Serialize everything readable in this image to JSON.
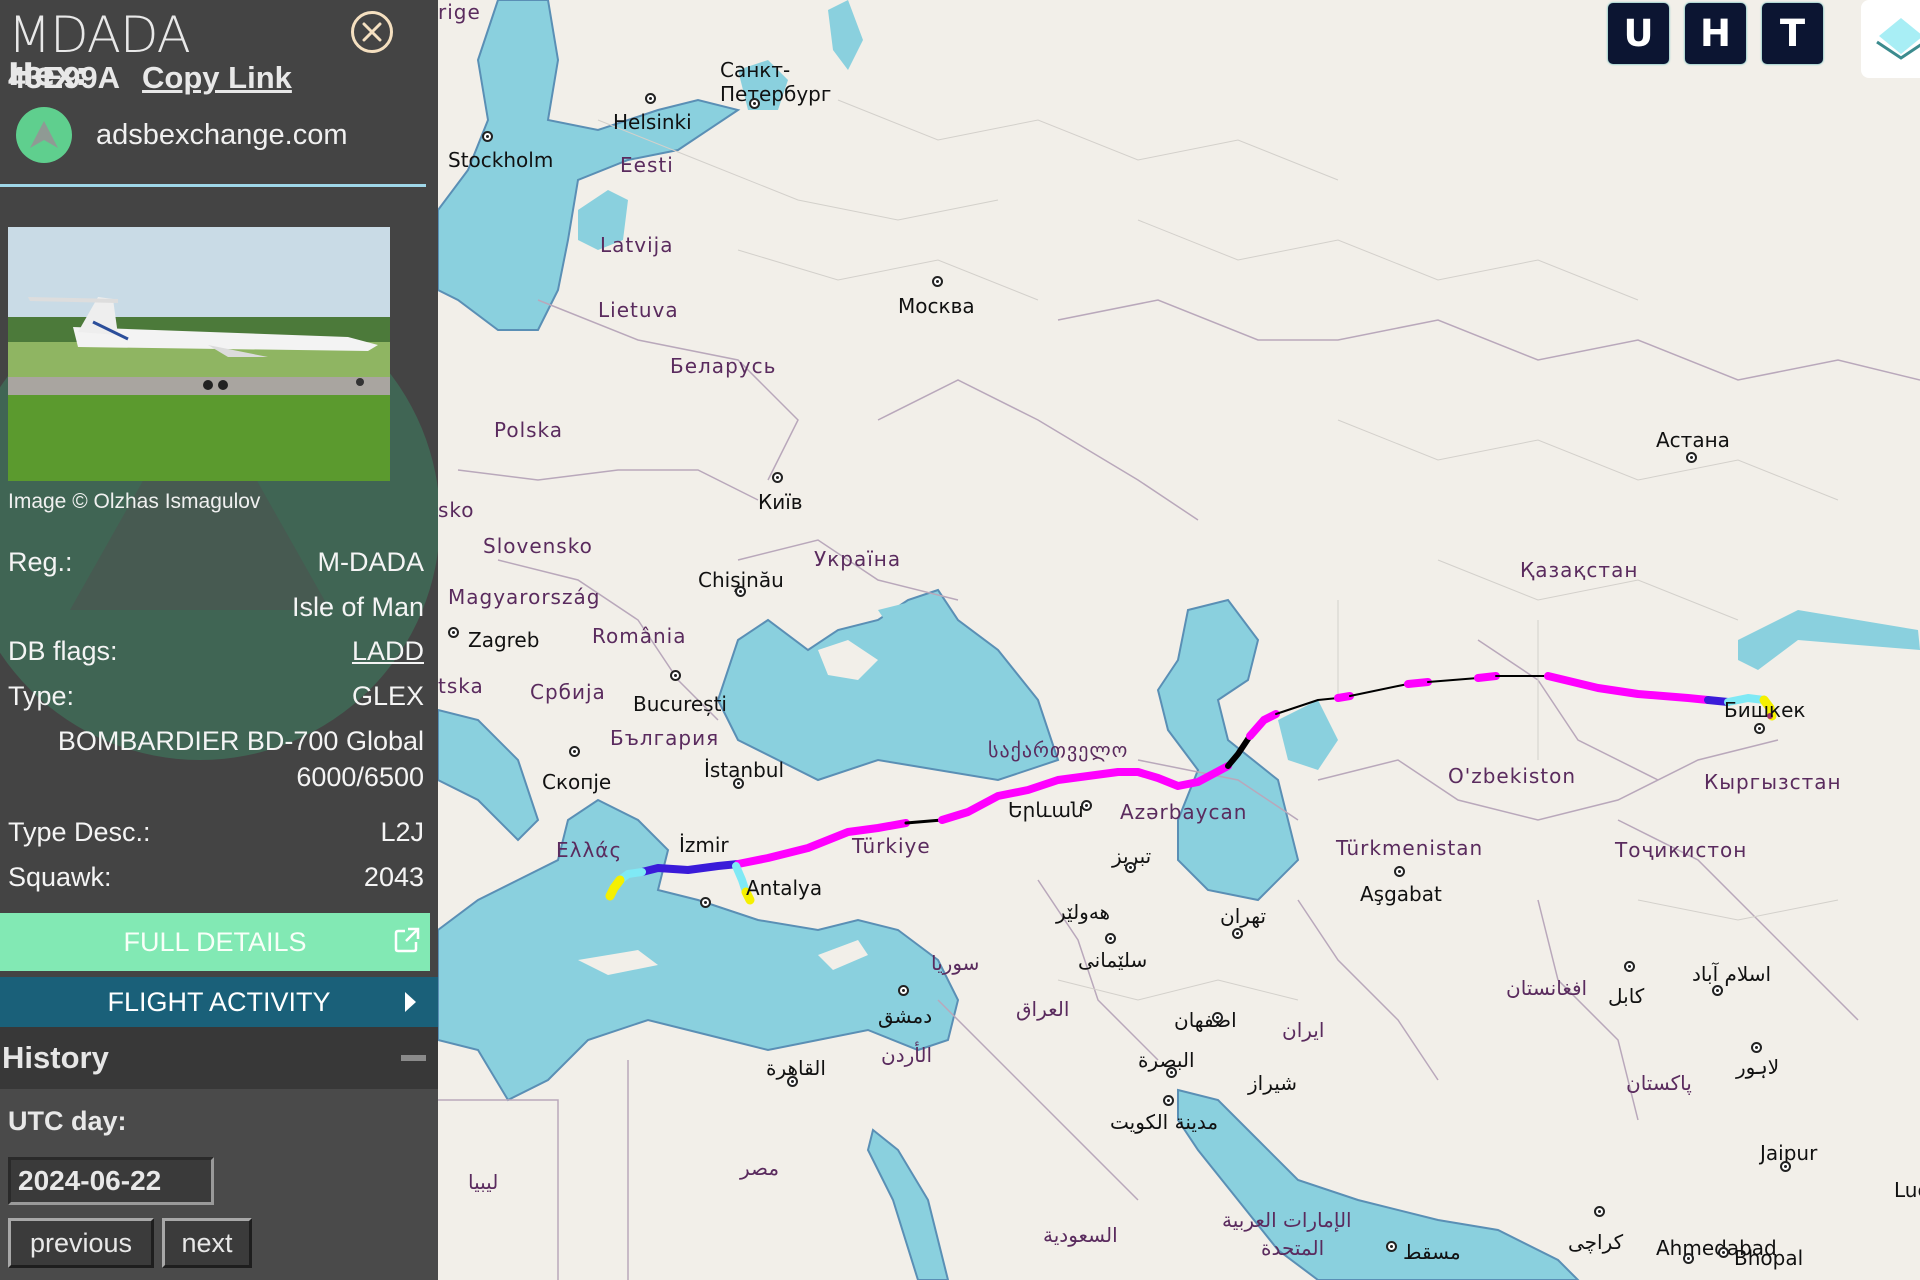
{
  "aircraft": {
    "title": "MDADA",
    "hex_label": "Hex:",
    "hex": "43E99A",
    "copy_link": "Copy Link",
    "source": "adsbexchange.com",
    "image_credit": "Image © Olzhas Ismagulov",
    "fields": [
      {
        "label": "Reg.:",
        "value": "M-DADA"
      },
      {
        "label": "",
        "value": "Isle of Man"
      },
      {
        "label": "DB flags:",
        "value": "LADD"
      },
      {
        "label": "Type:",
        "value": "GLEX"
      },
      {
        "label": "",
        "value": "BOMBARDIER BD-700 Global"
      },
      {
        "label": "",
        "value": "6000/6500"
      },
      {
        "label": "Type Desc.:",
        "value": "L2J"
      },
      {
        "label": "Squawk:",
        "value": "2043"
      }
    ]
  },
  "buttons": {
    "full_details": "FULL DETAILS",
    "flight_activity": "FLIGHT ACTIVITY"
  },
  "history": {
    "title": "History",
    "utc_label": "UTC day:",
    "date": "2024-06-22",
    "previous": "previous",
    "next": "next"
  },
  "toolbar": {
    "u": "U",
    "h": "H",
    "t": "T"
  },
  "colors": {
    "track_main": "#ff00ff",
    "track_gap": "#000000",
    "full_details_bg": "#82e9b4",
    "flight_activity_bg": "#1a6079",
    "water": "#8ad0de"
  },
  "map": {
    "cities": [
      "Stockholm",
      "Helsinki",
      "Санкт-",
      "Петербург",
      "Москва",
      "Київ",
      "Chișinău",
      "Zagreb",
      "București",
      "Скопје",
      "İstanbul",
      "İzmir",
      "Antalya",
      "Երևան",
      "تبریز",
      "هەولێر",
      "سلێمانی",
      "تهران",
      "Aşgabat",
      "اصفهان",
      "دمشق",
      "القاهرة",
      "البصرة",
      "شیراز",
      "مدينة الكويت",
      "مسقط",
      "كراچی",
      "Ahmedabad",
      "Bhopal",
      "Jaipur",
      "Luckn",
      "لاہور",
      "كابل",
      "اسلام آباد",
      "Бишкек",
      "Астана"
    ],
    "countries": [
      "rige",
      "Eesti",
      "Latvija",
      "Lietuva",
      "Беларусь",
      "Polska",
      "sko",
      "Slovensko",
      "Україна",
      "Magyarország",
      "România",
      "tska",
      "Србија",
      "България",
      "Ελλάς",
      "Türkiye",
      "საქართველო",
      "Azərbaycan",
      "Türkmenistan",
      "O'zbekiston",
      "Кыргызстан",
      "Тоҷикистон",
      "Қазақстан",
      "سوريا",
      "العراق",
      "ایران",
      "الأردن",
      "مصر",
      "ليبيا",
      "السعودية",
      "الإمارات العربية",
      "المتحدة",
      "افغانستان",
      "پاکستان"
    ]
  }
}
